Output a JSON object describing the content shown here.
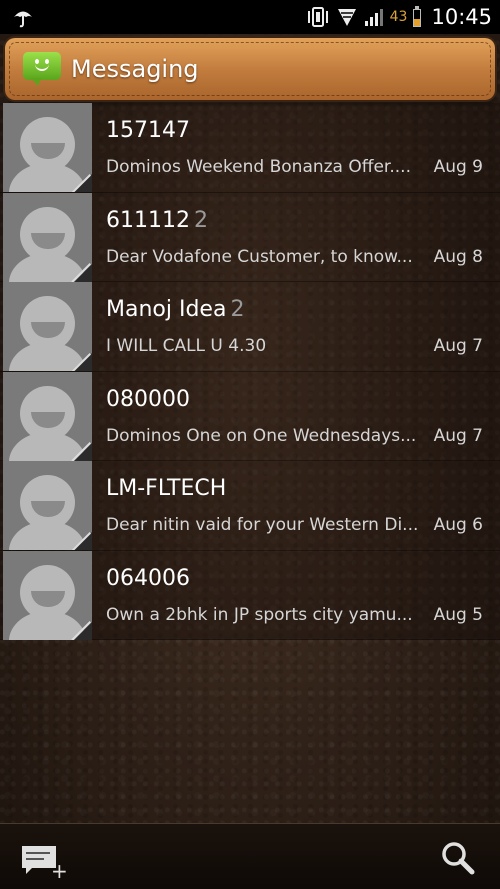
{
  "status_bar": {
    "battery_percent": "43",
    "battery_level": 0.43,
    "time": "10:45",
    "icons": [
      "umbrella-icon",
      "vibrate-icon",
      "wifi-icon",
      "signal-icon",
      "battery-icon"
    ]
  },
  "header": {
    "title": "Messaging",
    "icon": "messaging-app-icon",
    "accent": "#c98a4a"
  },
  "threads": [
    {
      "sender": "157147",
      "count": "",
      "preview": "Dominos Weekend Bonanza Offer....",
      "date": "Aug 9"
    },
    {
      "sender": "611112",
      "count": "2",
      "preview": "Dear Vodafone Customer, to know...",
      "date": "Aug 8"
    },
    {
      "sender": "Manoj Idea",
      "count": "2",
      "preview": "I WILL CALL U 4.30",
      "date": "Aug 7"
    },
    {
      "sender": "080000",
      "count": "",
      "preview": "Dominos One on One Wednesdays...",
      "date": "Aug 7"
    },
    {
      "sender": "LM-FLTECH",
      "count": "",
      "preview": "Dear nitin vaid for your Western Di...",
      "date": "Aug 6"
    },
    {
      "sender": "064006",
      "count": "",
      "preview": "Own a 2bhk in JP sports city yamu...",
      "date": "Aug 5"
    }
  ],
  "bottom_bar": {
    "compose_icon": "compose-new-message-icon",
    "search_icon": "search-icon"
  }
}
